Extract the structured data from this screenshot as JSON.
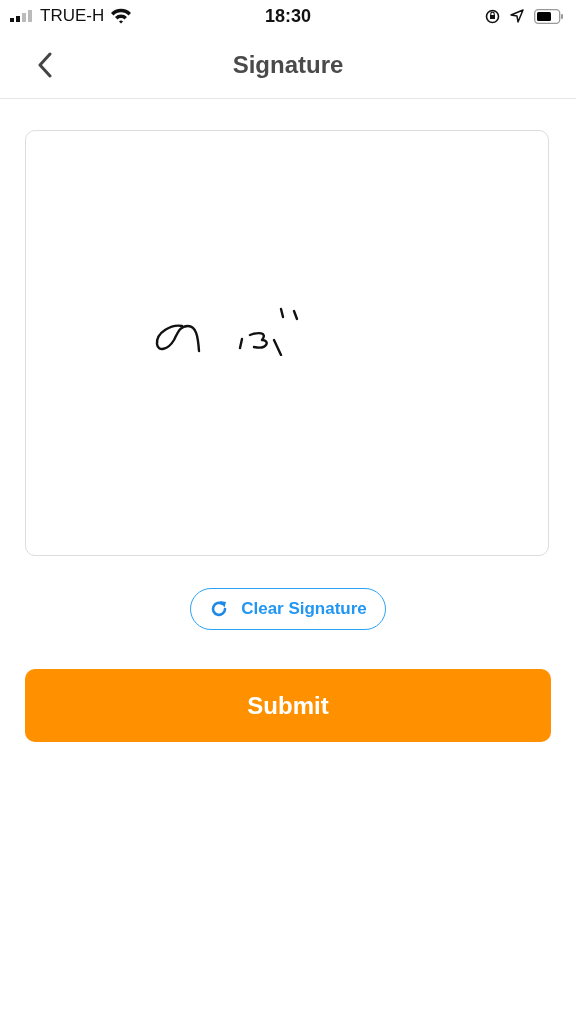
{
  "status_bar": {
    "carrier": "TRUE-H",
    "time": "18:30"
  },
  "header": {
    "title": "Signature"
  },
  "clear_button": {
    "label": "Clear Signature"
  },
  "submit_button": {
    "label": "Submit"
  }
}
